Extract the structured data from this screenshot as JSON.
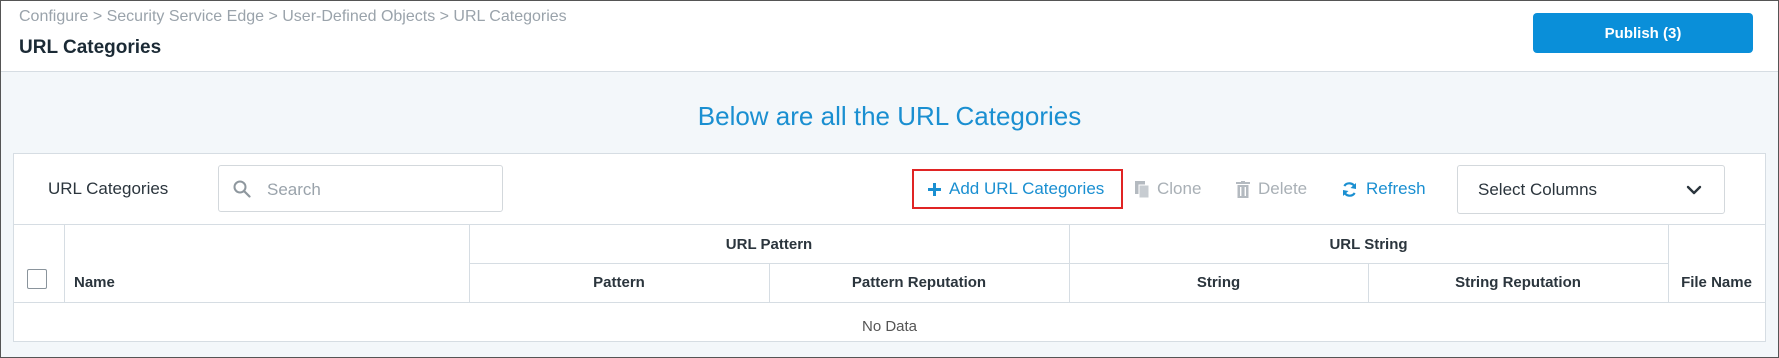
{
  "header": {
    "breadcrumb": "Configure > Security Service Edge > User-Defined Objects > URL Categories",
    "title": "URL Categories",
    "publish_label": "Publish (3)"
  },
  "banner": "Below are all the URL Categories",
  "toolbar": {
    "title": "URL Categories",
    "search_placeholder": "Search",
    "add_label": "Add URL Categories",
    "clone_label": "Clone",
    "delete_label": "Delete",
    "refresh_label": "Refresh",
    "select_columns_label": "Select Columns"
  },
  "table": {
    "groups": {
      "url_pattern": "URL Pattern",
      "url_string": "URL String"
    },
    "columns": {
      "name": "Name",
      "pattern": "Pattern",
      "pattern_reputation": "Pattern Reputation",
      "string": "String",
      "string_reputation": "String Reputation",
      "file_name": "File Name"
    },
    "empty_text": "No Data"
  },
  "colors": {
    "accent": "#0a8fd9",
    "link": "#1a8fd1",
    "highlight": "#e02424",
    "disabled": "#a9b0b6"
  }
}
